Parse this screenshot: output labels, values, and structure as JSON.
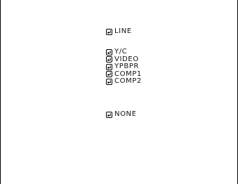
{
  "menu": {
    "icon": "enter-return-icon",
    "groups": [
      {
        "items": [
          {
            "label": "LINE"
          }
        ]
      },
      {
        "items": [
          {
            "label": "Y/C"
          },
          {
            "label": "VIDEO"
          },
          {
            "label": "YPBPR"
          },
          {
            "label": "COMP1"
          },
          {
            "label": "COMP2"
          }
        ]
      },
      {
        "items": [
          {
            "label": "NONE"
          }
        ]
      }
    ]
  },
  "colors": {
    "background": "#ffffff",
    "border": "#000000",
    "text": "#111111"
  }
}
